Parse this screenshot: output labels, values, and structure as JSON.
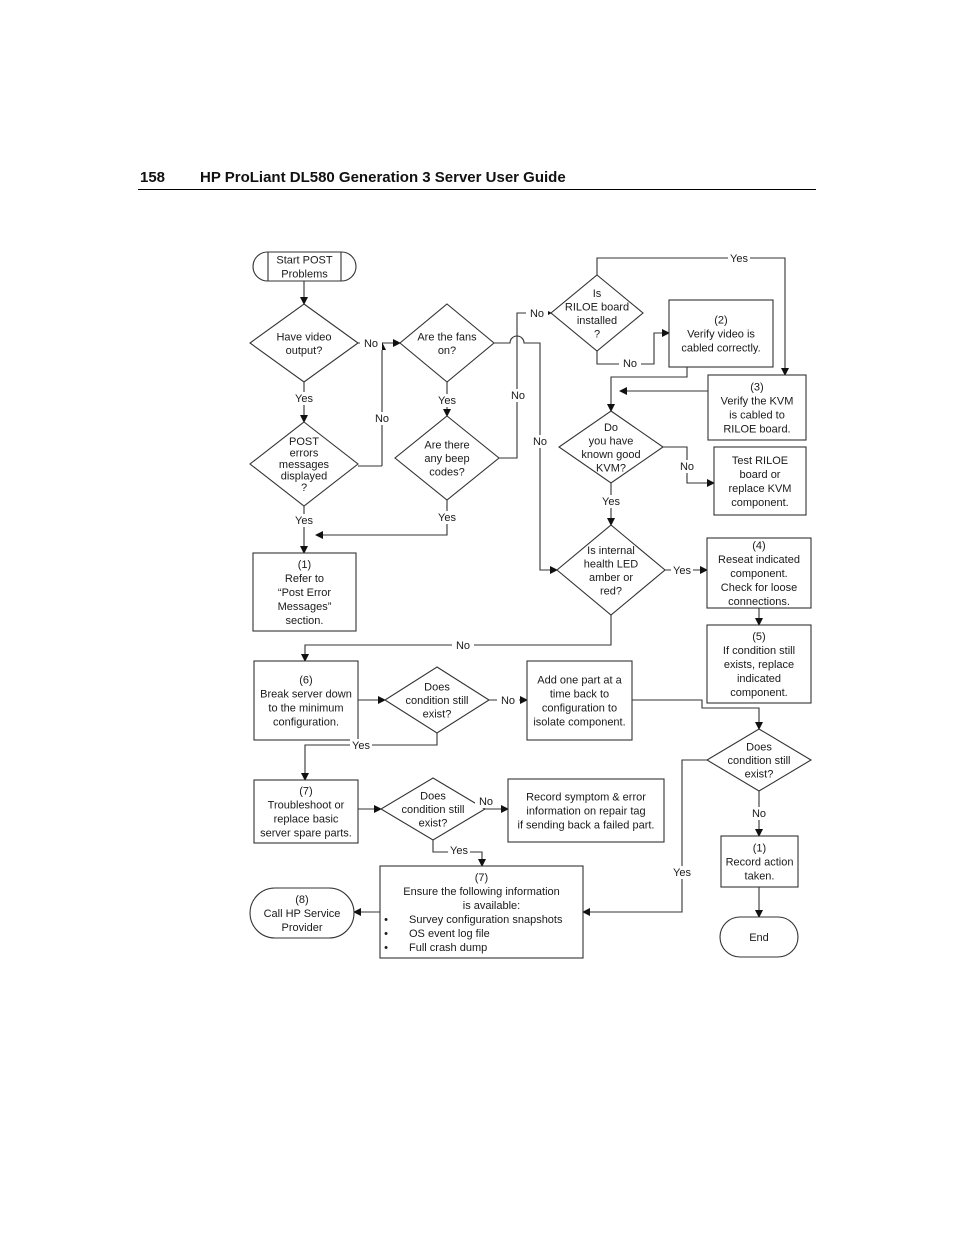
{
  "header": {
    "page_number": "158",
    "title": "HP ProLiant DL580 Generation 3 Server User Guide"
  },
  "flowchart": {
    "nodes": {
      "start": [
        "Start POST",
        "Problems"
      ],
      "video": [
        "Have video",
        "output?"
      ],
      "fans": [
        "Are the fans",
        "on?"
      ],
      "riloe": [
        "Is",
        "RILOE board",
        "installed",
        "?"
      ],
      "verify_video": [
        "(2)",
        "Verify video is",
        "cabled correctly."
      ],
      "verify_kvm": [
        "(3)",
        "Verify the KVM",
        "is cabled to",
        "RILOE board."
      ],
      "post_errors": [
        "POST",
        "errors",
        "messages",
        "displayed",
        "?"
      ],
      "beep": [
        "Are there",
        "any beep",
        "codes?"
      ],
      "known_kvm": [
        "Do",
        "you have",
        "known good",
        "KVM?"
      ],
      "test_riloe": [
        "Test RILOE",
        "board or",
        "replace KVM",
        "component."
      ],
      "refer": [
        "(1)",
        "Refer to",
        "“Post Error",
        "Messages”",
        "section."
      ],
      "health_led": [
        "Is internal",
        "health LED",
        "amber or",
        "red?"
      ],
      "reseat": [
        "(4)",
        "Reseat indicated",
        "component.",
        "Check for loose",
        "connections."
      ],
      "replace": [
        "(5)",
        "If condition still",
        "exists, replace",
        "indicated",
        "component."
      ],
      "break_down": [
        "(6)",
        "Break server down",
        "to the minimum",
        "configuration."
      ],
      "cond1": [
        "Does",
        "condition still",
        "exist?"
      ],
      "add_part": [
        "Add one part at a",
        "time back to",
        "configuration to",
        "isolate component."
      ],
      "cond3": [
        "Does",
        "condition still",
        "exist?"
      ],
      "troubleshoot": [
        "(7)",
        "Troubleshoot or",
        "replace basic",
        "server spare parts."
      ],
      "cond2": [
        "Does",
        "condition still",
        "exist?"
      ],
      "record_symptom": [
        "Record symptom & error",
        "information on repair tag",
        "if sending back a failed part."
      ],
      "record_action": [
        "(1)",
        "Record action",
        "taken."
      ],
      "call_hp": [
        "(8)",
        "Call HP Service",
        "Provider"
      ],
      "ensure_info": {
        "lines": [
          "(7)",
          "Ensure the following information",
          "is available:"
        ],
        "bullets": [
          "Survey configuration snapshots",
          "OS event log file",
          "Full crash dump"
        ]
      },
      "end": [
        "End"
      ]
    },
    "edge_labels": {
      "yes": "Yes",
      "no": "No",
      "bullet": "•"
    }
  }
}
